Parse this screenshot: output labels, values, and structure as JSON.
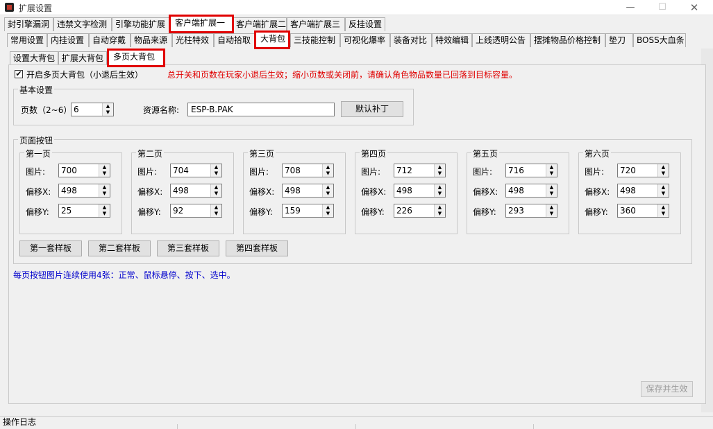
{
  "window": {
    "title": "扩展设置"
  },
  "tabs_row1": [
    "封引擎漏洞",
    "违禁文字检测",
    "引擎功能扩展",
    "客户端扩展一",
    "客户端扩展二",
    "客户端扩展三",
    "反挂设置"
  ],
  "tabs_row2": [
    "常用设置",
    "内挂设置",
    "自动穿戴",
    "物品来源",
    "光柱特效",
    "自动拾取",
    "大背包",
    "三技能控制",
    "可视化爆率",
    "装备对比",
    "特效编辑",
    "上线透明公告",
    "摆摊物品价格控制",
    "垫刀",
    "BOSS大血条"
  ],
  "tabs_row3": [
    "设置大背包",
    "扩展大背包",
    "多页大背包"
  ],
  "enable": {
    "label": "开启多页大背包（小退后生效）",
    "checked_glyph": "✔"
  },
  "warning": "总开关和页数在玩家小退后生效；缩小页数或关闭前，请确认角色物品数量已回落到目标容量。",
  "basic": {
    "title": "基本设置",
    "pages_label": "页数（2~6）",
    "pages_value": "6",
    "resource_label": "资源名称:",
    "resource_value": "ESP-B.PAK",
    "default_patch_button": "默认补丁"
  },
  "page_buttons": {
    "title": "页面按钮",
    "image_label": "图片:",
    "offset_x_label": "偏移X:",
    "offset_y_label": "偏移Y:",
    "pages": [
      {
        "name": "第一页",
        "image": "700",
        "x": "498",
        "y": "25"
      },
      {
        "name": "第二页",
        "image": "704",
        "x": "498",
        "y": "92"
      },
      {
        "name": "第三页",
        "image": "708",
        "x": "498",
        "y": "159"
      },
      {
        "name": "第四页",
        "image": "712",
        "x": "498",
        "y": "226"
      },
      {
        "name": "第五页",
        "image": "716",
        "x": "498",
        "y": "293"
      },
      {
        "name": "第六页",
        "image": "720",
        "x": "498",
        "y": "360"
      }
    ],
    "templates": [
      "第一套样板",
      "第二套样板",
      "第三套样板",
      "第四套样板"
    ]
  },
  "hint": "每页按钮图片连续使用4张：正常、鼠标悬停、按下、选中。",
  "save_button": "保存并生效",
  "status": "操作日志",
  "colors": {
    "highlight": "#e00000",
    "warning": "#e00000",
    "hint": "#0000cc"
  }
}
